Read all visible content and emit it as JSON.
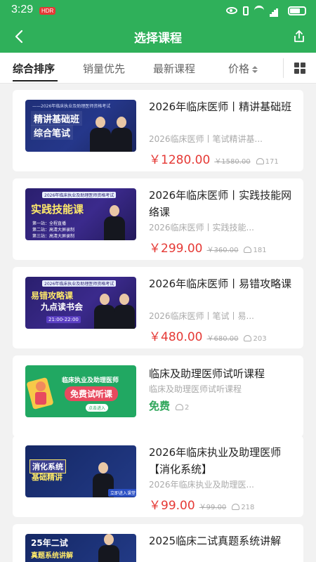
{
  "status_bar": {
    "time": "3:29",
    "badge": "HDR"
  },
  "header": {
    "title": "选择课程"
  },
  "sort_tabs": [
    {
      "label": "综合排序",
      "active": true
    },
    {
      "label": "销量优先",
      "active": false
    },
    {
      "label": "最新课程",
      "active": false
    },
    {
      "label": "价格",
      "active": false
    }
  ],
  "courses": [
    {
      "title": "2026年临床医师丨精讲基础班",
      "subtitle": "2026临床医师丨笔试精讲基...",
      "price": "￥1280.00",
      "old_price": "￥1580.00",
      "learners": "171",
      "thumb": {
        "top": "——2026年临床执业及助理医师资格考试",
        "line1": "精讲基础班",
        "line2": "综合笔试"
      }
    },
    {
      "title": "2026年临床医师丨实践技能网络课",
      "subtitle": "2026临床医师丨实践技能...",
      "price": "￥299.00",
      "old_price": "￥360.00",
      "learners": "181",
      "thumb": {
        "top": "2026年临床执业及助理医师资格考试",
        "line1": "实践技能课",
        "items": [
          "第一站：全程直播",
          "第二站：高清大屏录制",
          "第三站：高清大屏录制"
        ]
      }
    },
    {
      "title": "2026年临床医师丨易错攻略课",
      "subtitle": "2026临床医师丨笔试丨易...",
      "price": "￥480.00",
      "old_price": "￥680.00",
      "learners": "203",
      "thumb": {
        "top": "2026年临床执业及助理医师资格考试",
        "line1": "易错攻略课",
        "line2": "九点读书会",
        "time": "21:00-22:00"
      }
    },
    {
      "title": "临床及助理医师试听课程",
      "subtitle": "临床及助理医师试听课程",
      "price": "免费",
      "old_price": "",
      "learners": "2",
      "thumb": {
        "line1": "临床执业及助理医师",
        "line2": "免费试听课",
        "button": "点击进入"
      }
    },
    {
      "title": "2026年临床执业及助理医师【消化系统】",
      "subtitle": "2026年临床执业及助理医...",
      "price": "￥99.00",
      "old_price": "￥99.00",
      "learners": "218",
      "thumb": {
        "line1": "消化系统",
        "line2": "基础精讲",
        "button": "立即进入课堂"
      }
    },
    {
      "title": "2025临床二试真题系统讲解",
      "subtitle": "",
      "price": "",
      "old_price": "",
      "learners": "",
      "thumb": {
        "line1": "25年二试",
        "line2": "真题系统讲解"
      }
    }
  ],
  "colors": {
    "primary": "#2fb05a",
    "price": "#e53935"
  }
}
